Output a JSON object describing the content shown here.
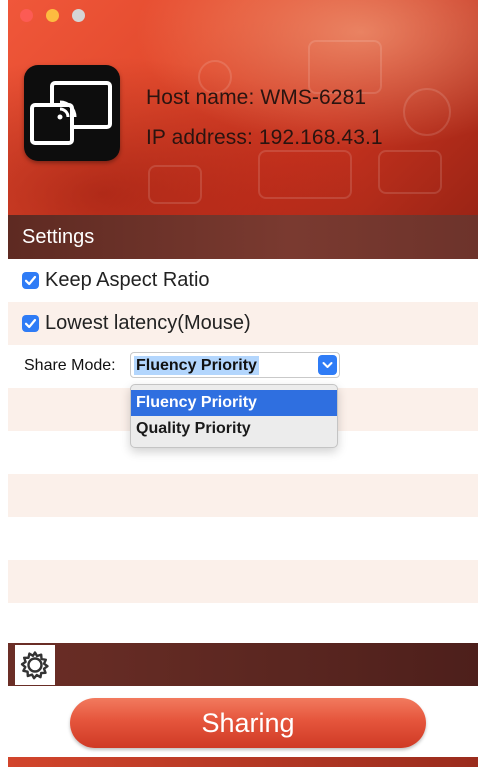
{
  "window": {
    "controls": [
      "close",
      "minimize",
      "zoom"
    ],
    "icon": "screen-cast-icon"
  },
  "header": {
    "host_line": "Host name:  WMS-6281",
    "ip_line": "IP address:  192.168.43.1"
  },
  "settings": {
    "title": "Settings",
    "keep_aspect_ratio": {
      "label": "Keep Aspect Ratio",
      "checked": true
    },
    "lowest_latency": {
      "label": "Lowest latency(Mouse)",
      "checked": true
    },
    "share_mode": {
      "label": "Share Mode:",
      "value": "Fluency Priority",
      "options": [
        "Fluency Priority",
        "Quality Priority"
      ],
      "highlighted_option": "Fluency Priority"
    }
  },
  "toolbar": {
    "settings_icon": "gear-icon",
    "sharing_label": "Sharing"
  },
  "colors": {
    "accent_blue": "#2f7cf6",
    "banner_red": "#e24a2d",
    "settings_bar": "#6d332b",
    "row_tint": "#fbf0ea"
  }
}
